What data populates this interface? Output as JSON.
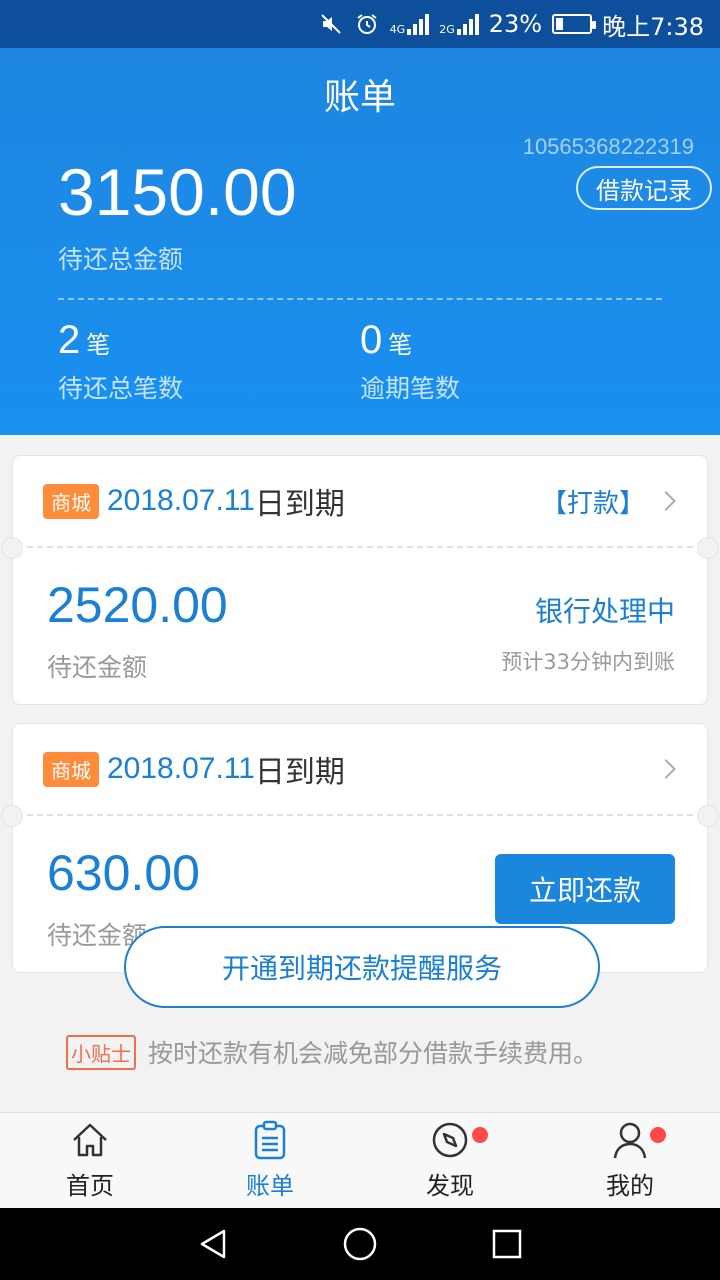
{
  "status_bar": {
    "network1": "4G",
    "network2": "2G",
    "battery_percent": "23%",
    "battery_level": 0.23,
    "time": "晚上7:38"
  },
  "header": {
    "title": "账单",
    "account_id": "10565368222319",
    "loan_record_label": "借款记录",
    "total_amount": "3150.00",
    "total_label": "待还总金额",
    "pending_count": "2",
    "pending_unit": "笔",
    "pending_label": "待还总笔数",
    "overdue_count": "0",
    "overdue_unit": "笔",
    "overdue_label": "逾期笔数"
  },
  "bills": [
    {
      "tag": "商城",
      "due_date": "2018.07.11",
      "due_suffix": "日到期",
      "status_link": "【打款】",
      "amount": "2520.00",
      "amount_label": "待还金额",
      "status": "银行处理中",
      "eta": "预计33分钟内到账"
    },
    {
      "tag": "商城",
      "due_date": "2018.07.11",
      "due_suffix": "日到期",
      "amount": "630.00",
      "amount_label": "待还金额",
      "repay_label": "立即还款"
    }
  ],
  "reminder_label": "开通到期还款提醒服务",
  "tip": {
    "tag": "小贴士",
    "text": "按时还款有机会减免部分借款手续费用。"
  },
  "tabs": [
    {
      "label": "首页",
      "icon": "home-icon"
    },
    {
      "label": "账单",
      "icon": "bill-icon",
      "active": true
    },
    {
      "label": "发现",
      "icon": "compass-icon",
      "badge": true
    },
    {
      "label": "我的",
      "icon": "user-icon",
      "badge": true
    }
  ],
  "colors": {
    "header_blue": "#1890f0",
    "accent_blue": "#1a80d6",
    "mall_tag": "#ff8c3a",
    "tip_red": "#f06e4c",
    "badge_red": "#ff4a4a"
  }
}
